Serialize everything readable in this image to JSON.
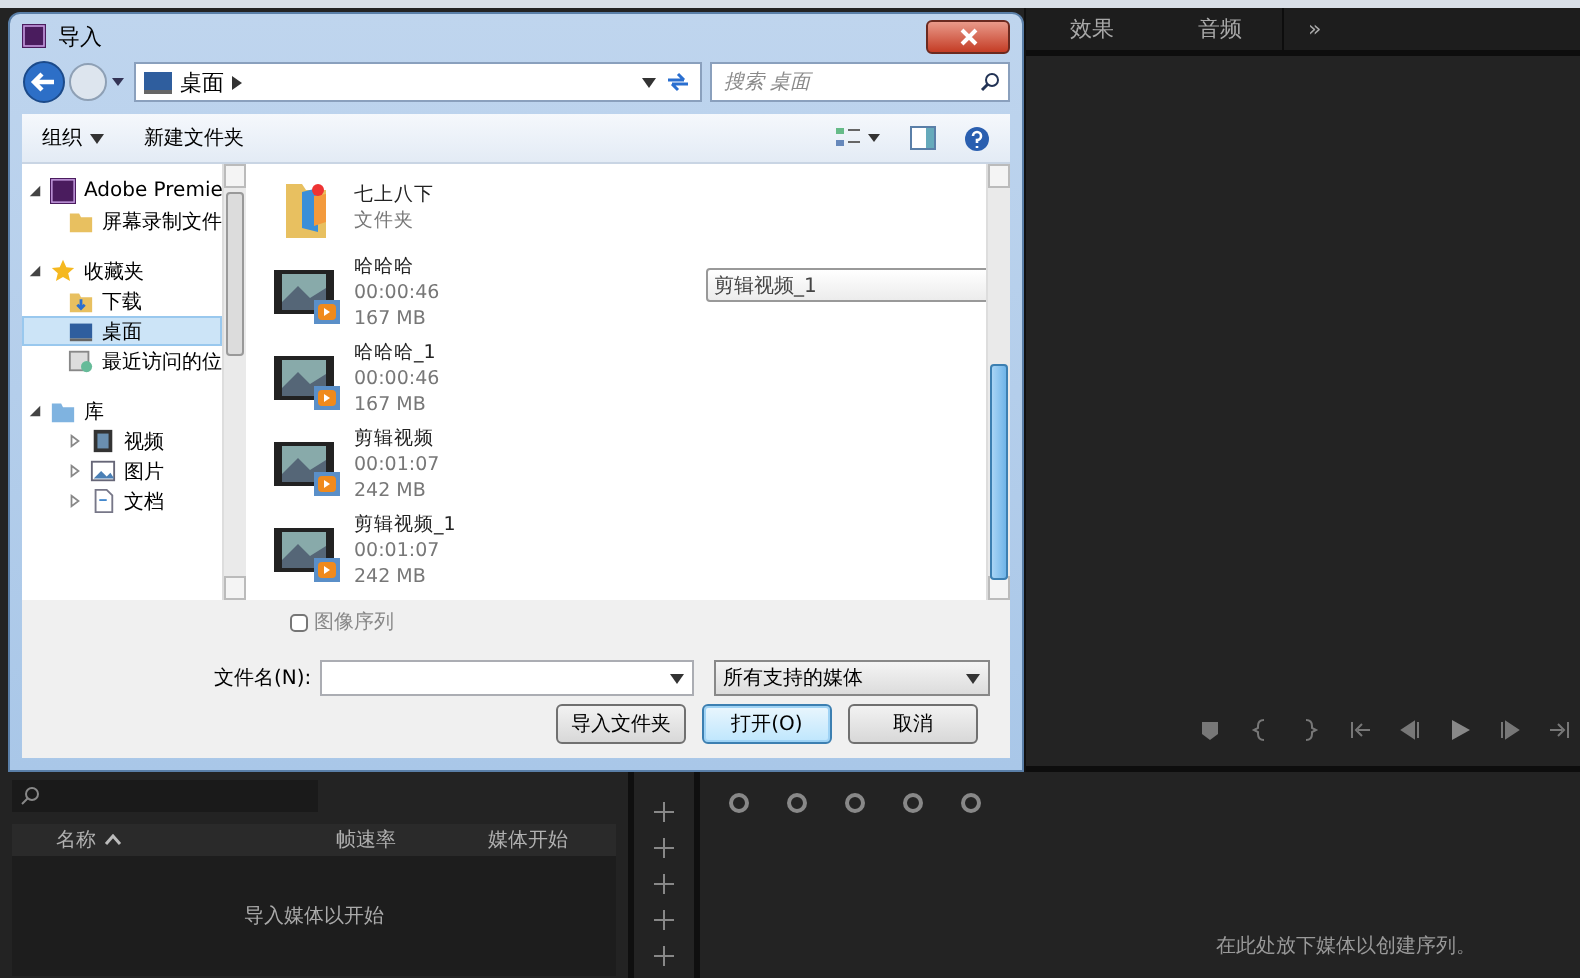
{
  "editor": {
    "tabs": [
      {
        "label": "效果"
      },
      {
        "label": "音频"
      }
    ],
    "tab_overflow": "»",
    "project_panel": {
      "columns": [
        {
          "label": "名称",
          "sorted": true
        },
        {
          "label": "帧速率",
          "sorted": false
        },
        {
          "label": "媒体开始",
          "sorted": false
        }
      ],
      "empty_message": "导入媒体以开始"
    },
    "timeline": {
      "empty_message": "在此处放下媒体以创建序列。"
    }
  },
  "dialog": {
    "title": "导入",
    "address": "桌面",
    "search": {
      "placeholder": "搜索 桌面"
    },
    "toolbar": {
      "organize": "组织",
      "new_folder": "新建文件夹"
    },
    "nav_tree": [
      {
        "label": "Adobe Premie",
        "kind": "premiere",
        "expanded": true,
        "selected": false,
        "children": [
          {
            "label": "屏幕录制文件",
            "kind": "folder",
            "selected": false
          }
        ]
      },
      {
        "label": "收藏夹",
        "kind": "star",
        "expanded": true,
        "selected": false,
        "children": [
          {
            "label": "下载",
            "kind": "download",
            "selected": false
          },
          {
            "label": "桌面",
            "kind": "desktop",
            "selected": true
          },
          {
            "label": "最近访问的位",
            "kind": "recent",
            "selected": false
          }
        ]
      },
      {
        "label": "库",
        "kind": "library",
        "expanded": true,
        "selected": false,
        "children": [
          {
            "label": "视频",
            "kind": "video",
            "expanded": false,
            "selected": false
          },
          {
            "label": "图片",
            "kind": "picture",
            "expanded": false,
            "selected": false
          },
          {
            "label": "文档",
            "kind": "document",
            "expanded": false,
            "selected": false
          }
        ]
      }
    ],
    "files": [
      {
        "kind": "folder",
        "name": "七上八下",
        "type": "文件夹"
      },
      {
        "kind": "video",
        "name": "哈哈哈",
        "duration": "00:00:46",
        "size": "167 MB"
      },
      {
        "kind": "video",
        "name": "哈哈哈_1",
        "duration": "00:00:46",
        "size": "167 MB"
      },
      {
        "kind": "video",
        "name": "剪辑视频",
        "duration": "00:01:07",
        "size": "242 MB"
      },
      {
        "kind": "video",
        "name": "剪辑视频_1",
        "duration": "00:01:07",
        "size": "242 MB"
      }
    ],
    "tooltip": "剪辑视频_1",
    "image_sequence": {
      "label": "图像序列",
      "checked": false
    },
    "filename": {
      "label": "文件名(N):"
    },
    "filetype": "所有支持的媒体",
    "buttons": [
      {
        "label": "导入文件夹",
        "default": false
      },
      {
        "label": "打开(O)",
        "default": true
      },
      {
        "label": "取消",
        "default": false
      }
    ]
  }
}
